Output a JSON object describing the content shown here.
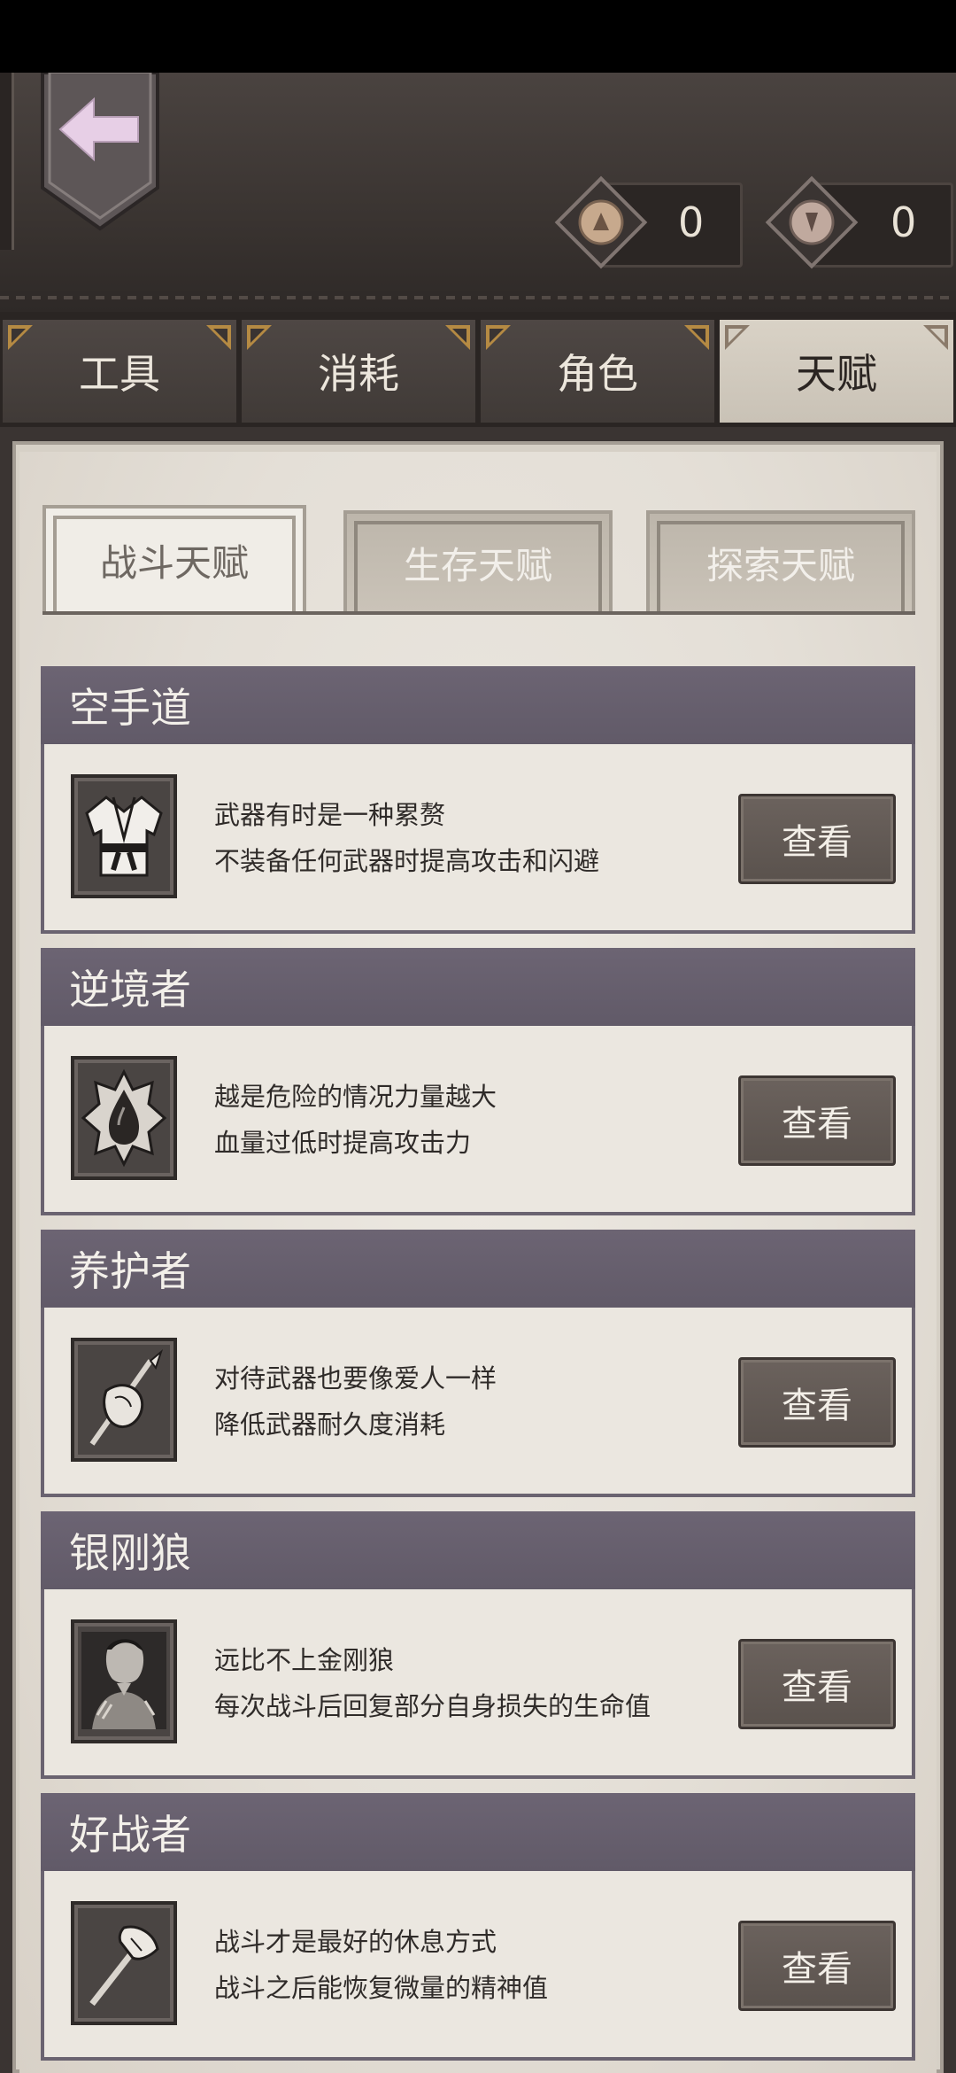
{
  "currencies": [
    {
      "name": "coin-a",
      "value": "0"
    },
    {
      "name": "coin-b",
      "value": "0"
    }
  ],
  "tabs": [
    {
      "label": "工具"
    },
    {
      "label": "消耗"
    },
    {
      "label": "角色"
    },
    {
      "label": "天赋"
    }
  ],
  "active_tab": "天赋",
  "subtabs": [
    {
      "label": "战斗天赋"
    },
    {
      "label": "生存天赋"
    },
    {
      "label": "探索天赋"
    }
  ],
  "active_subtab": "战斗天赋",
  "talents": [
    {
      "title": "空手道",
      "line1": "武器有时是一种累赘",
      "line2": "不装备任何武器时提高攻击和闪避",
      "button": "查看",
      "icon": "karate-gi-icon"
    },
    {
      "title": "逆境者",
      "line1": "越是危险的情况力量越大",
      "line2": "血量过低时提高攻击力",
      "button": "查看",
      "icon": "blood-drop-icon"
    },
    {
      "title": "养护者",
      "line1": "对待武器也要像爱人一样",
      "line2": "降低武器耐久度消耗",
      "button": "查看",
      "icon": "spear-cloth-icon"
    },
    {
      "title": "银刚狼",
      "line1": "远比不上金刚狼",
      "line2": "每次战斗后回复部分自身损失的生命值",
      "button": "查看",
      "icon": "wolverine-portrait-icon"
    },
    {
      "title": "好战者",
      "line1": "战斗才是最好的休息方式",
      "line2": "战斗之后能恢复微量的精神值",
      "button": "查看",
      "icon": "axe-icon"
    }
  ]
}
